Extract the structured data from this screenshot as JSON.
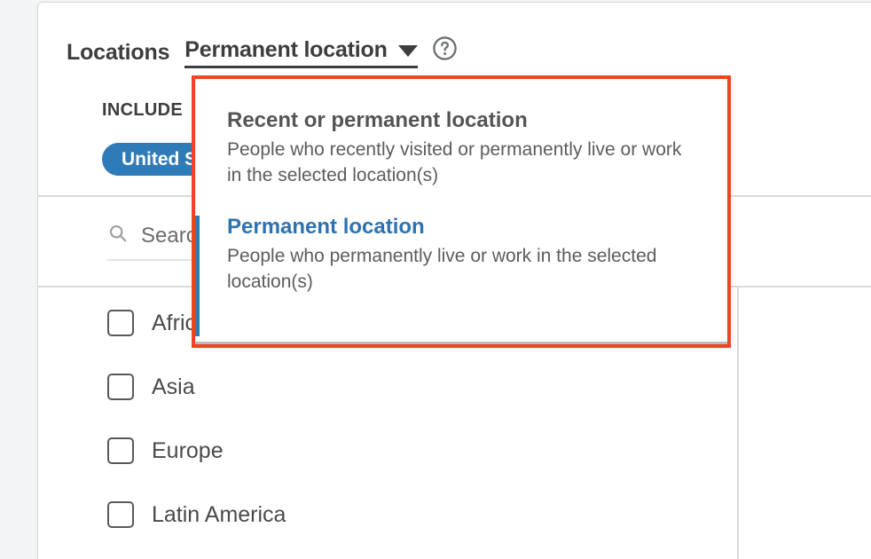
{
  "header": {
    "title": "Locations",
    "dropdown_trigger_label": "Permanent location",
    "caret_icon": "chevron-down-icon",
    "help_icon": "help-circle-icon"
  },
  "include_section": {
    "label": "INCLUDE",
    "chips": [
      {
        "label": "United States"
      }
    ]
  },
  "search": {
    "icon": "search-icon",
    "placeholder": "Search",
    "value": ""
  },
  "location_list": {
    "items": [
      {
        "label": "Africa",
        "checked": false
      },
      {
        "label": "Asia",
        "checked": false
      },
      {
        "label": "Europe",
        "checked": false
      },
      {
        "label": "Latin America",
        "checked": false
      }
    ]
  },
  "dropdown_menu": {
    "highlight_color": "#ef4323",
    "selected_index": 1,
    "options": [
      {
        "title": "Recent or permanent location",
        "description": "People who recently visited or permanently live or work in the selected location(s)",
        "selected": false
      },
      {
        "title": "Permanent location",
        "description": "People who permanently live or work in the selected location(s)",
        "selected": true
      }
    ]
  },
  "colors": {
    "accent_blue": "#2f7bb8",
    "link_blue": "#2e73b0",
    "highlight_red": "#ef4323",
    "text_dark": "#3d3d3d",
    "text_body": "#5c5c5c",
    "divider": "#d7dadc",
    "page_background": "#f3f4f5"
  }
}
